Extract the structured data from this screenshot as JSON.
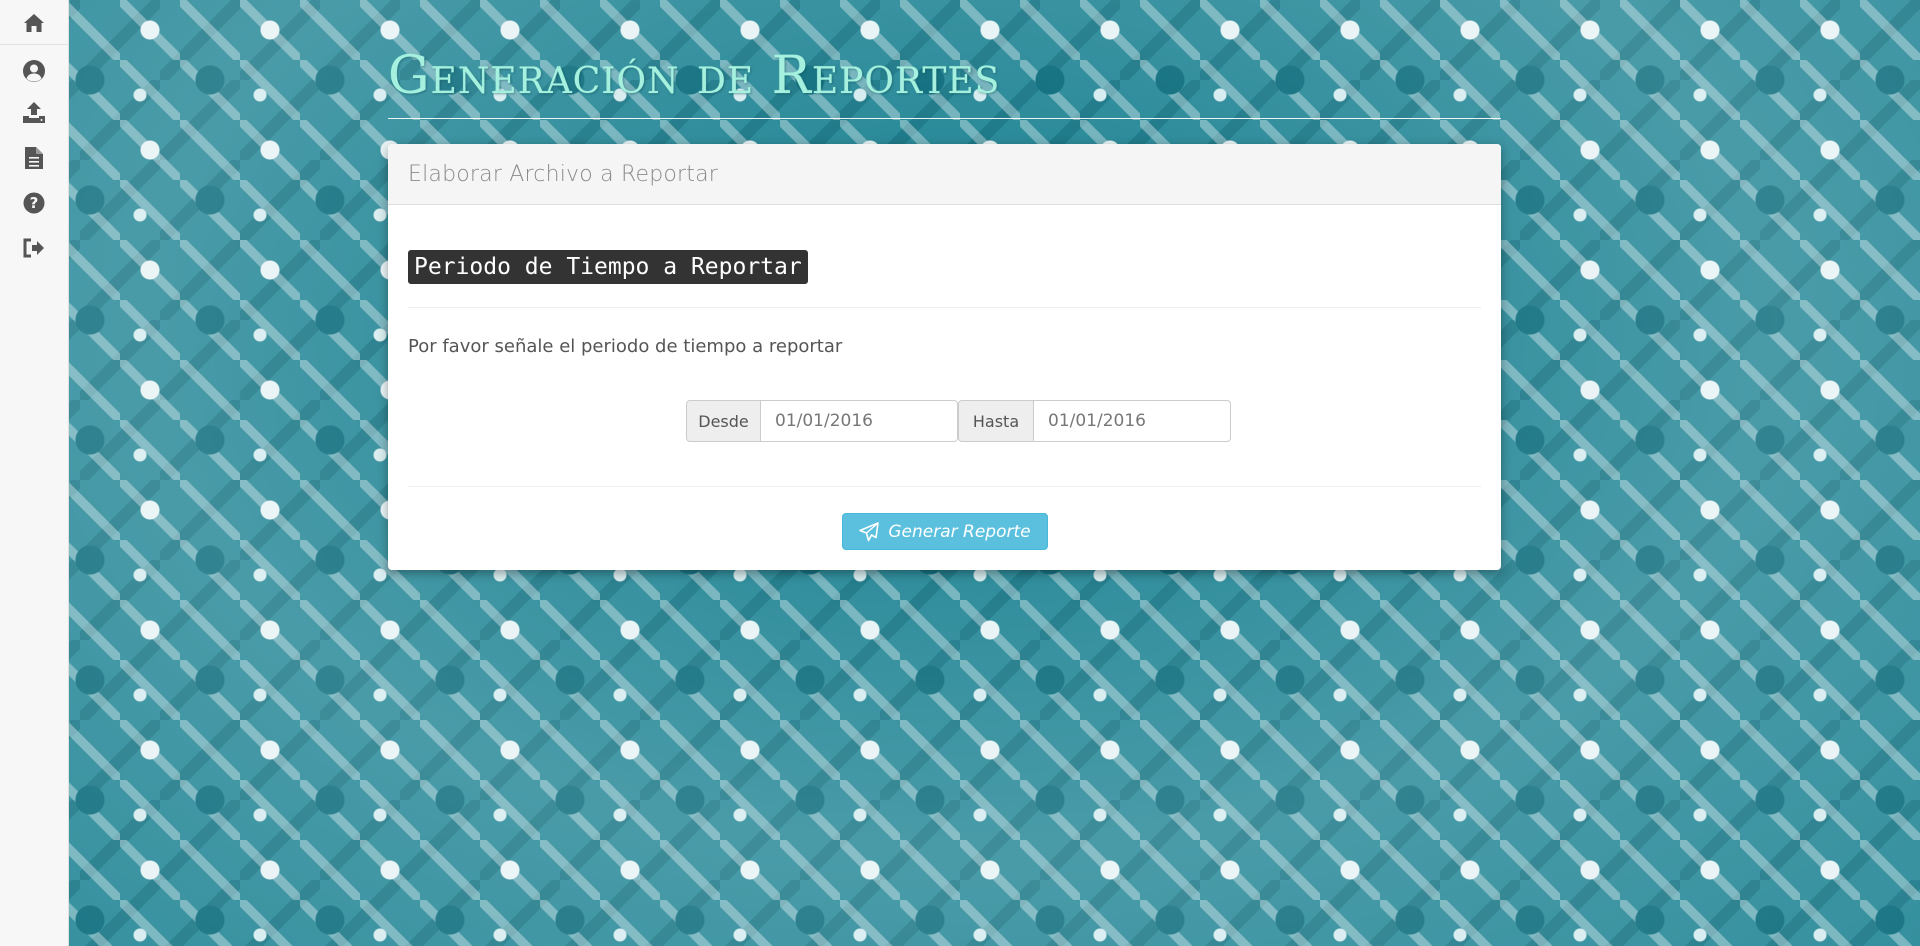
{
  "sidebar": {
    "items": [
      {
        "icon": "home-icon"
      },
      {
        "icon": "user-circle-icon"
      },
      {
        "icon": "upload-icon"
      },
      {
        "icon": "file-text-icon"
      },
      {
        "icon": "question-circle-icon"
      },
      {
        "icon": "sign-out-icon"
      }
    ]
  },
  "header": {
    "title": "Generación de Reportes"
  },
  "panel": {
    "heading": "Elaborar Archivo a Reportar",
    "section_label": "Periodo de Tiempo a Reportar",
    "instruction": "Por favor señale el periodo de tiempo a reportar",
    "from_label": "Desde",
    "from_value": "01/01/2016",
    "to_label": "Hasta",
    "to_value": "01/01/2016",
    "submit_label": "Generar Reporte",
    "submit_icon": "paper-plane-icon"
  },
  "colors": {
    "title": "#a6f0df",
    "button": "#5bc0de",
    "background_pattern": "#2a8a99"
  }
}
